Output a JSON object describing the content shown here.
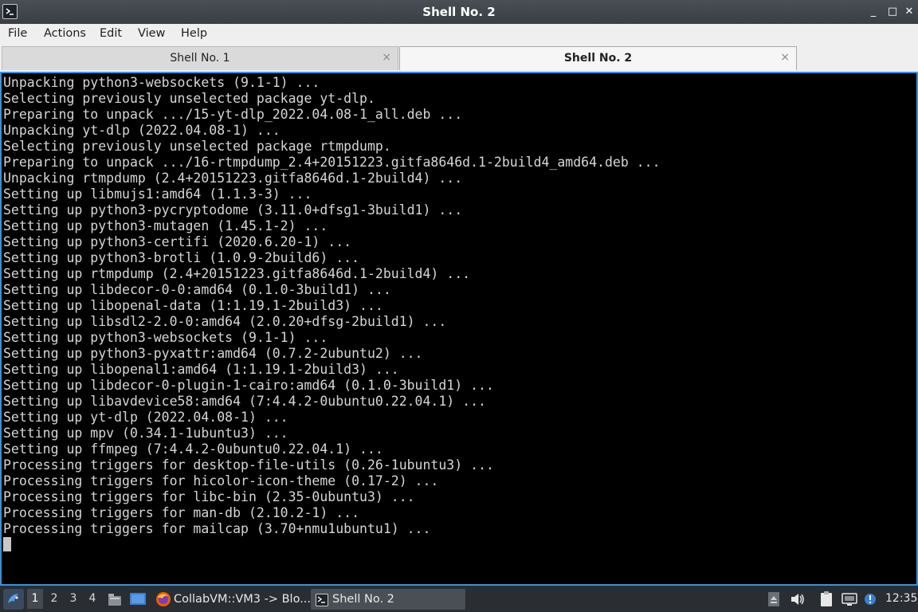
{
  "window": {
    "title": "Shell No. 2",
    "controls": {
      "minimize": "_",
      "maximize": "□",
      "close": "✕"
    }
  },
  "menu": [
    "File",
    "Actions",
    "Edit",
    "View",
    "Help"
  ],
  "tabs": [
    {
      "label": "Shell No. 1",
      "close": "×",
      "active": false
    },
    {
      "label": "Shell No. 2",
      "close": "×",
      "active": true
    }
  ],
  "terminal": {
    "lines": [
      "Unpacking python3-websockets (9.1-1) ...",
      "Selecting previously unselected package yt-dlp.",
      "Preparing to unpack .../15-yt-dlp_2022.04.08-1_all.deb ...",
      "Unpacking yt-dlp (2022.04.08-1) ...",
      "Selecting previously unselected package rtmpdump.",
      "Preparing to unpack .../16-rtmpdump_2.4+20151223.gitfa8646d.1-2build4_amd64.deb ...",
      "Unpacking rtmpdump (2.4+20151223.gitfa8646d.1-2build4) ...",
      "Setting up libmujs1:amd64 (1.1.3-3) ...",
      "Setting up python3-pycryptodome (3.11.0+dfsg1-3build1) ...",
      "Setting up python3-mutagen (1.45.1-2) ...",
      "Setting up python3-certifi (2020.6.20-1) ...",
      "Setting up python3-brotli (1.0.9-2build6) ...",
      "Setting up rtmpdump (2.4+20151223.gitfa8646d.1-2build4) ...",
      "Setting up libdecor-0-0:amd64 (0.1.0-3build1) ...",
      "Setting up libopenal-data (1:1.19.1-2build3) ...",
      "Setting up libsdl2-2.0-0:amd64 (2.0.20+dfsg-2build1) ...",
      "Setting up python3-websockets (9.1-1) ...",
      "Setting up python3-pyxattr:amd64 (0.7.2-2ubuntu2) ...",
      "Setting up libopenal1:amd64 (1:1.19.1-2build3) ...",
      "Setting up libdecor-0-plugin-1-cairo:amd64 (0.1.0-3build1) ...",
      "Setting up libavdevice58:amd64 (7:4.4.2-0ubuntu0.22.04.1) ...",
      "Setting up yt-dlp (2022.04.08-1) ...",
      "Setting up mpv (0.34.1-1ubuntu3) ...",
      "Setting up ffmpeg (7:4.4.2-0ubuntu0.22.04.1) ...",
      "Processing triggers for desktop-file-utils (0.26-1ubuntu3) ...",
      "Processing triggers for hicolor-icon-theme (0.17-2) ...",
      "Processing triggers for libc-bin (2.35-0ubuntu3) ...",
      "Processing triggers for man-db (2.10.2-1) ...",
      "Processing triggers for mailcap (3.70+nmu1ubuntu1) ..."
    ]
  },
  "taskbar": {
    "workspaces": [
      "1",
      "2",
      "3",
      "4"
    ],
    "active_workspace": "1",
    "tasks": [
      {
        "label": "CollabVM::VM3 -> Blo...",
        "icon": "firefox-icon"
      },
      {
        "label": "Shell No. 2",
        "icon": "terminal-icon"
      }
    ],
    "clock": "12:35"
  },
  "colors": {
    "terminal_bg": "#000000",
    "terminal_fg": "#d6d6d6",
    "accent": "#3d8fd8",
    "taskbar_bg": "#2a2d31"
  }
}
